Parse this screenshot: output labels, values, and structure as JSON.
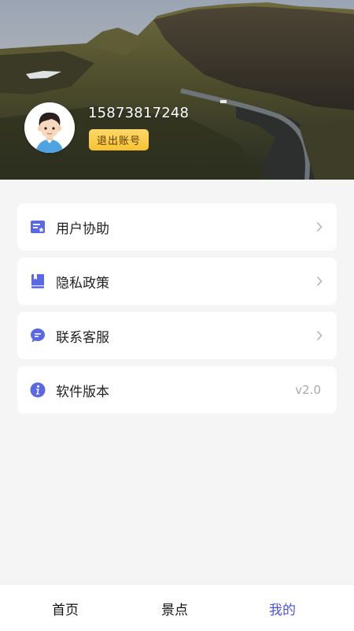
{
  "profile": {
    "phone": "15873817248",
    "logout_label": "退出账号"
  },
  "menu": [
    {
      "label": "用户协助",
      "icon": "feedback-card-icon",
      "trailing": "chevron"
    },
    {
      "label": "隐私政策",
      "icon": "book-icon",
      "trailing": "chevron"
    },
    {
      "label": "联系客服",
      "icon": "chat-bubble-icon",
      "trailing": "chevron"
    },
    {
      "label": "软件版本",
      "icon": "info-icon",
      "trailing": "v2.0"
    }
  ],
  "tabbar": {
    "items": [
      "首页",
      "景点",
      "我的"
    ],
    "active": "我的"
  },
  "colors": {
    "accent": "#4a55d8",
    "icon": "#5b68e6",
    "logout_button": "#f8c232",
    "background": "#f5f5f5"
  }
}
